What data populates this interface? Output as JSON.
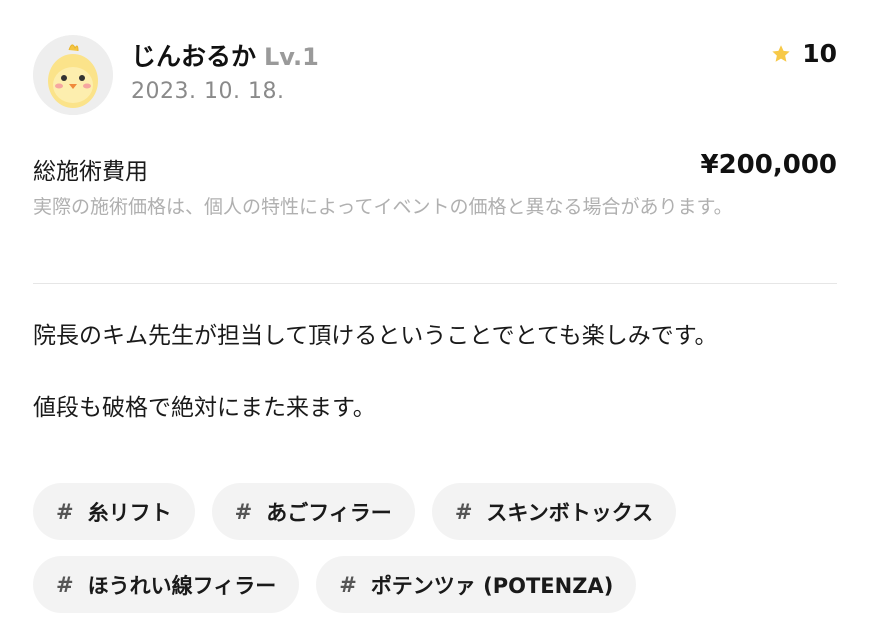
{
  "review": {
    "user_name": "じんおるか",
    "user_level": "Lv.1",
    "date": "2023. 10. 18.",
    "rating": "10",
    "cost_label": "総施術費用",
    "cost_value": "¥200,000",
    "cost_note": "実際の施術価格は、個人の特性によってイベントの価格と異なる場合があります。",
    "body": [
      "院長のキム先生が担当して頂けるということでとても楽しみです。",
      "値段も破格で絶対にまた来ます。"
    ],
    "tag_hash": "#",
    "tags": [
      "糸リフト",
      "あごフィラー",
      "スキンボトックス",
      "ほうれい線フィラー",
      "ポテンツァ (POTENZA)"
    ]
  },
  "colors": {
    "star": "#F7C948",
    "note_text": "#B0B0B0",
    "tag_bg": "#F3F3F3",
    "avatar_bg": "#EEEEEE",
    "chick_body": "#FBE38A"
  },
  "icons": {
    "avatar": "chick-avatar-icon",
    "rating": "star-icon"
  }
}
